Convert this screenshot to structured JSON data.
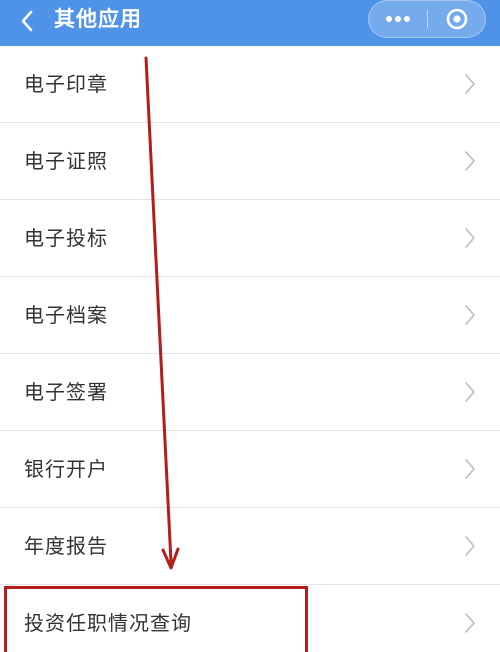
{
  "header": {
    "title": "其他应用",
    "bg_color": "#4f93e8"
  },
  "list": {
    "items": [
      {
        "label": "电子印章"
      },
      {
        "label": "电子证照"
      },
      {
        "label": "电子投标"
      },
      {
        "label": "电子档案"
      },
      {
        "label": "电子签署"
      },
      {
        "label": "银行开户"
      },
      {
        "label": "年度报告"
      },
      {
        "label": "投资任职情况查询"
      }
    ]
  },
  "annotation": {
    "color": "#b51d1d",
    "highlighted_item": "投资任职情况查询"
  },
  "icons": {
    "back": "chevron-left-icon",
    "more": "more-dots-icon",
    "close": "circle-target-icon",
    "row": "chevron-right-icon"
  }
}
